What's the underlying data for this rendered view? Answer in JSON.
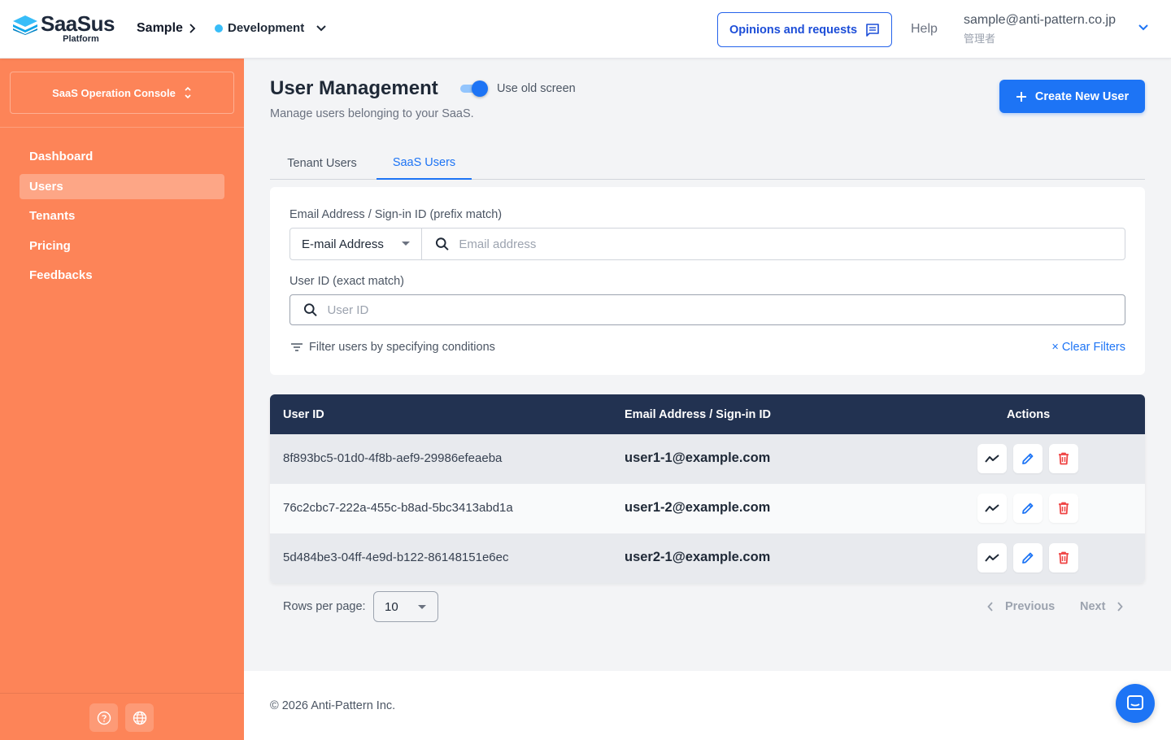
{
  "header": {
    "logo_name": "SaaSus",
    "logo_sub": "Platform",
    "app_name": "Sample",
    "environment": "Development",
    "opinions_label": "Opinions and requests",
    "help_label": "Help",
    "account_email": "sample@anti-pattern.co.jp",
    "account_role": "管理者"
  },
  "sidebar": {
    "console_label": "SaaS Operation Console",
    "items": [
      {
        "label": "Dashboard",
        "active": false
      },
      {
        "label": "Users",
        "active": true
      },
      {
        "label": "Tenants",
        "active": false
      },
      {
        "label": "Pricing",
        "active": false
      },
      {
        "label": "Feedbacks",
        "active": false
      }
    ]
  },
  "page": {
    "title": "User Management",
    "toggle_label": "Use old screen",
    "toggle_on": true,
    "subtitle": "Manage users belonging to your SaaS.",
    "create_button": "Create New User"
  },
  "tabs": [
    {
      "label": "Tenant Users",
      "active": false
    },
    {
      "label": "SaaS Users",
      "active": true
    }
  ],
  "filters": {
    "email_label": "Email Address / Sign-in ID (prefix match)",
    "email_type": "E-mail Address",
    "email_placeholder": "Email address",
    "userid_label": "User ID (exact match)",
    "userid_placeholder": "User ID",
    "conditions_label": "Filter users by specifying conditions",
    "clear_label": "× Clear Filters"
  },
  "table": {
    "columns": [
      "User ID",
      "Email Address / Sign-in ID",
      "Actions"
    ],
    "rows": [
      {
        "id": "8f893bc5-01d0-4f8b-aef9-29986efeaeba",
        "email": "user1-1@example.com"
      },
      {
        "id": "76c2cbc7-222a-455c-b8ad-5bc3413abd1a",
        "email": "user1-2@example.com"
      },
      {
        "id": "5d484be3-04ff-4e9d-b122-86148151e6ec",
        "email": "user2-1@example.com"
      }
    ]
  },
  "pagination": {
    "rows_label": "Rows per page:",
    "rows_value": "10",
    "prev_label": "Previous",
    "next_label": "Next"
  },
  "footer": {
    "copyright": "© 2026 Anti-Pattern Inc."
  },
  "colors": {
    "sidebar": "#fd8458",
    "primary": "#1d74f5",
    "table_header": "#223251",
    "delete": "#ef4444"
  }
}
